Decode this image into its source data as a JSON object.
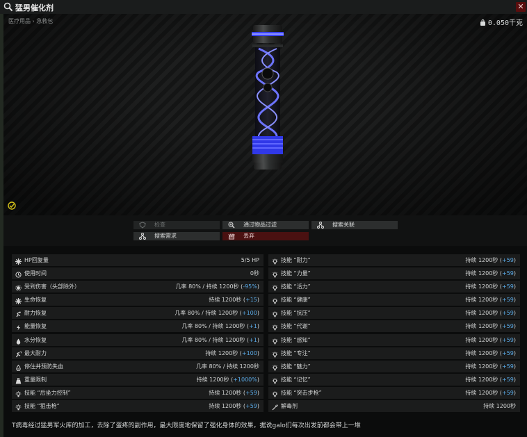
{
  "window": {
    "title": "猛男催化剂",
    "breadcrumb": "医疗用品 › 急救包",
    "weight": "0.050千克",
    "close": "✕"
  },
  "actions": [
    {
      "label": "检查",
      "icon": "shield-icon",
      "state": "disabled"
    },
    {
      "label": "通过物品过滤",
      "icon": "magnifier-plus-icon",
      "state": "normal"
    },
    {
      "label": "搜索关联",
      "icon": "network-icon",
      "state": "normal"
    },
    {
      "label": "搜索需求",
      "icon": "network-icon",
      "state": "normal"
    },
    {
      "label": "丢弃",
      "icon": "discard-icon",
      "state": "danger"
    }
  ],
  "effects_left": [
    {
      "name": "HP回复量",
      "prefix": "5/5 HP",
      "suffix": "",
      "highlight": "",
      "icon": "health-icon"
    },
    {
      "name": "使用时间",
      "prefix": "0秒",
      "suffix": "",
      "highlight": "",
      "icon": "clock-icon"
    },
    {
      "name": "受到伤害（头部除外）",
      "prefix": "几率 80% / 持续 1200秒 (",
      "highlight": "-95%",
      "suffix": ")",
      "icon": "damage-icon"
    },
    {
      "name": "生命恢复",
      "prefix": "持续 1200秒 (",
      "highlight": "+15",
      "suffix": ")",
      "icon": "health-icon"
    },
    {
      "name": "耐力恢复",
      "prefix": "几率 80% / 持续 1200秒 (",
      "highlight": "+100",
      "suffix": ")",
      "icon": "stamina-icon"
    },
    {
      "name": "能量恢复",
      "prefix": "几率 80% / 持续 1200秒 (",
      "highlight": "+1",
      "suffix": ")",
      "icon": "energy-icon"
    },
    {
      "name": "水分恢复",
      "prefix": "几率 80% / 持续 1200秒 (",
      "highlight": "+1",
      "suffix": ")",
      "icon": "water-icon"
    },
    {
      "name": "最大耐力",
      "prefix": "持续 1200秒 (",
      "highlight": "+100",
      "suffix": ")",
      "icon": "max-stamina-icon"
    },
    {
      "name": "停住并预防失血",
      "prefix": "几率 80% / 持续 1200秒",
      "highlight": "",
      "suffix": "",
      "icon": "blood-icon"
    },
    {
      "name": "重量限制",
      "prefix": "持续 1200秒 (",
      "highlight": "+1000%",
      "suffix": ")",
      "icon": "weight-icon"
    },
    {
      "name": "技能 “后坐力控制”",
      "prefix": "持续 1200秒 (",
      "highlight": "+59",
      "suffix": ")",
      "icon": "skill-icon"
    },
    {
      "name": "技能 “狙击枪”",
      "prefix": "持续 1200秒 (",
      "highlight": "+59",
      "suffix": ")",
      "icon": "skill-icon"
    }
  ],
  "effects_right": [
    {
      "name": "技能 “耐力”",
      "prefix": "持续 1200秒 (",
      "highlight": "+59",
      "suffix": ")",
      "icon": "skill-icon"
    },
    {
      "name": "技能 “力量”",
      "prefix": "持续 1200秒 (",
      "highlight": "+59",
      "suffix": ")",
      "icon": "skill-icon"
    },
    {
      "name": "技能 “活力”",
      "prefix": "持续 1200秒 (",
      "highlight": "+59",
      "suffix": ")",
      "icon": "skill-icon"
    },
    {
      "name": "技能 “健康”",
      "prefix": "持续 1200秒 (",
      "highlight": "+59",
      "suffix": ")",
      "icon": "skill-icon"
    },
    {
      "name": "技能 “抗压”",
      "prefix": "持续 1200秒 (",
      "highlight": "+59",
      "suffix": ")",
      "icon": "skill-icon"
    },
    {
      "name": "技能 “代谢”",
      "prefix": "持续 1200秒 (",
      "highlight": "+59",
      "suffix": ")",
      "icon": "skill-icon"
    },
    {
      "name": "技能 “感知”",
      "prefix": "持续 1200秒 (",
      "highlight": "+59",
      "suffix": ")",
      "icon": "skill-icon"
    },
    {
      "name": "技能 “专注”",
      "prefix": "持续 1200秒 (",
      "highlight": "+59",
      "suffix": ")",
      "icon": "skill-icon"
    },
    {
      "name": "技能 “魅力”",
      "prefix": "持续 1200秒 (",
      "highlight": "+59",
      "suffix": ")",
      "icon": "skill-icon"
    },
    {
      "name": "技能 “记忆”",
      "prefix": "持续 1200秒 (",
      "highlight": "+59",
      "suffix": ")",
      "icon": "skill-icon"
    },
    {
      "name": "技能 “突击步枪”",
      "prefix": "持续 1200秒 (",
      "highlight": "+59",
      "suffix": ")",
      "icon": "skill-icon"
    },
    {
      "name": "解毒剂",
      "prefix": "持续 1200秒",
      "highlight": "",
      "suffix": "",
      "icon": "antidote-icon"
    }
  ],
  "description": "T病毒经过猛男军火库的加工，去除了蛋疼的副作用，最大限度地保留了强化身体的效果，据说galo们每次出发前都会带上一堆",
  "colors": {
    "highlight": "#59a9e6",
    "accent_blue": "#4a53ff",
    "danger": "#4a1111"
  }
}
